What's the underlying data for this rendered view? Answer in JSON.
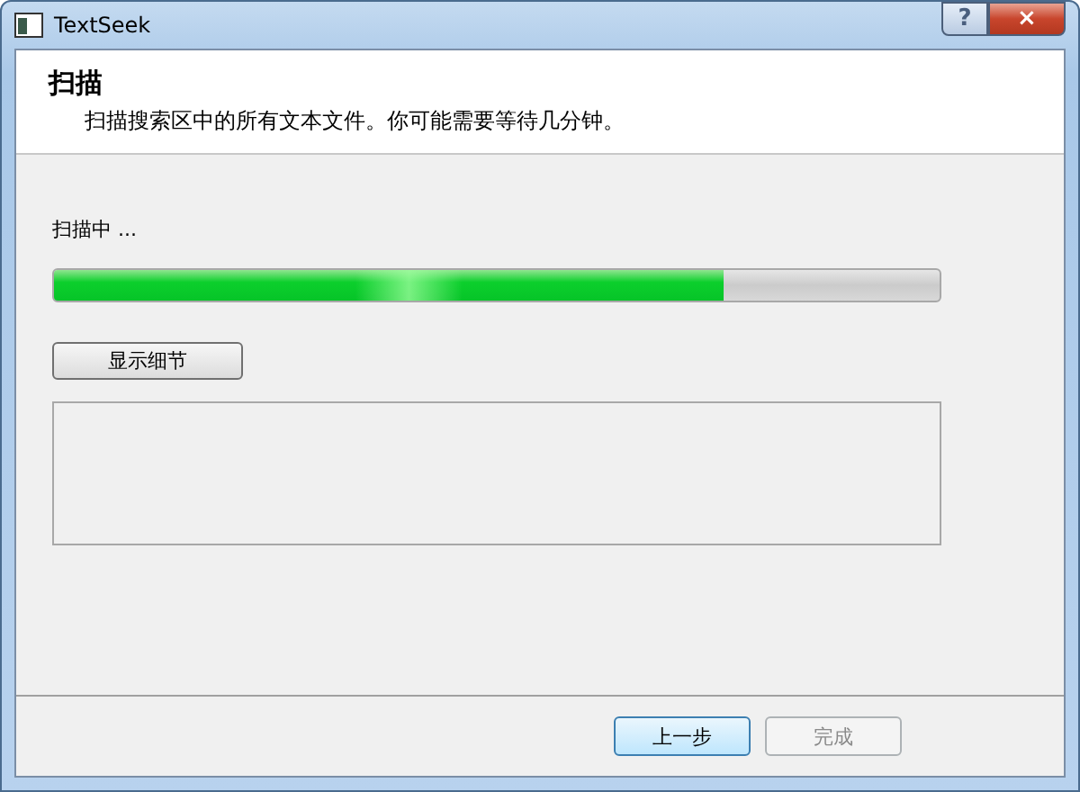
{
  "window": {
    "title": "TextSeek",
    "buttons": [
      "?",
      "×"
    ]
  },
  "header": {
    "title": "扫描",
    "subtitle": "扫描搜索区中的所有文本文件。你可能需要等待几分钟。"
  },
  "status": "扫描中 ...",
  "progress": {
    "level": 0.757
  },
  "details_button": "显示细节",
  "details_box": {
    "expanded": true
  },
  "buttons": [
    {
      "label": "上一步",
      "disabled": false,
      "kind": "default"
    },
    {
      "label": "完成",
      "disabled": true,
      "kind": "normal"
    }
  ]
}
